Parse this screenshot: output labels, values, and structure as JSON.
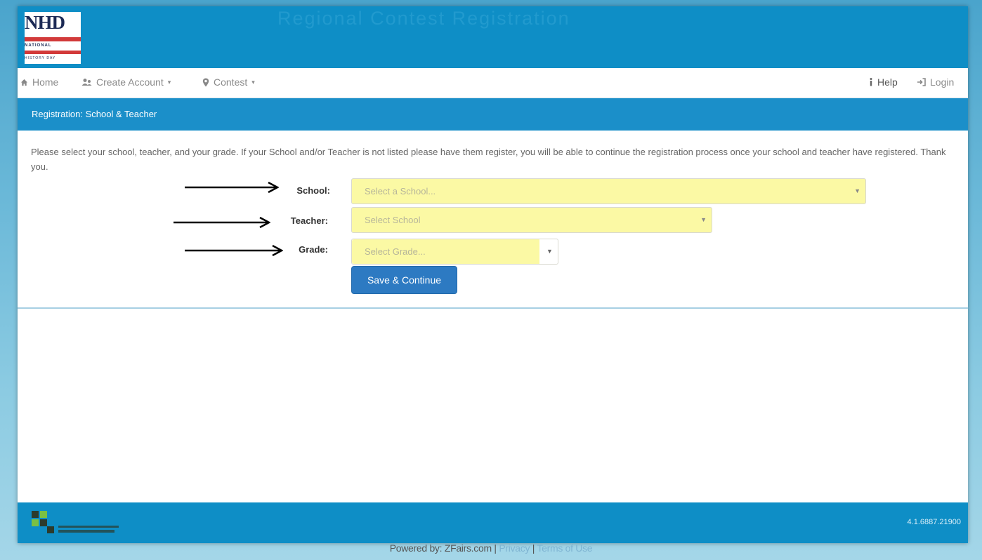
{
  "header": {
    "logo_text": "NHD",
    "logo_subtitle": "NATIONAL",
    "logo_subtitle2": "HISTORY DAY",
    "title": "Regional Contest Registration"
  },
  "navbar": {
    "home": "Home",
    "create_account": "Create Account",
    "contest": "Contest",
    "help": "Help",
    "login": "Login"
  },
  "panel": {
    "title": "Registration: School & Teacher",
    "intro": "Please select your school, teacher, and your grade. If your School and/or Teacher is not listed please have them register, you will be able to continue the registration process once your school and teacher have registered. Thank you."
  },
  "form": {
    "school_label": "School:",
    "school_placeholder": "Select a School...",
    "teacher_label": "Teacher:",
    "teacher_placeholder": "Select School",
    "grade_label": "Grade:",
    "grade_placeholder": "Select Grade...",
    "save_button": "Save & Continue"
  },
  "footer": {
    "version": "4.1.6887.21900",
    "powered_prefix": "Powered by: ZFairs.com |",
    "privacy": "Privacy",
    "separator": "|",
    "terms": "Terms of Use"
  },
  "colors": {
    "header_blue": "#0e8ec6",
    "select_yellow": "#fbf9a4",
    "button_blue": "#2d7ac2"
  }
}
